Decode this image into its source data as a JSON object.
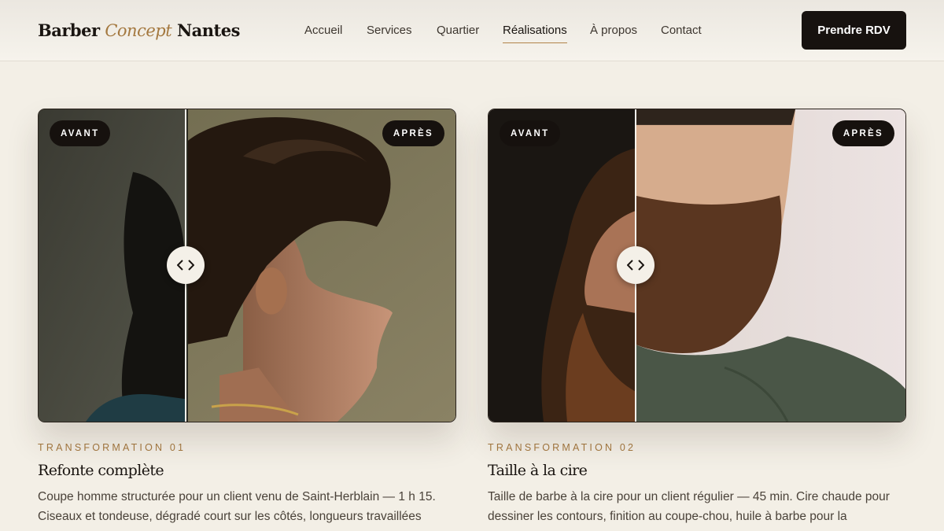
{
  "header": {
    "logo": {
      "part1": "Barber ",
      "part2": "Concept",
      "part3": " Nantes"
    },
    "nav": [
      {
        "label": "Accueil",
        "active": false
      },
      {
        "label": "Services",
        "active": false
      },
      {
        "label": "Quartier",
        "active": false
      },
      {
        "label": "Réalisations",
        "active": true
      },
      {
        "label": "À propos",
        "active": false
      },
      {
        "label": "Contact",
        "active": false
      }
    ],
    "cta_label": "Prendre RDV"
  },
  "cards": [
    {
      "before_label": "AVANT",
      "after_label": "APRÈS",
      "eyebrow": "TRANSFORMATION 01",
      "title": "Refonte complète",
      "description": "Coupe homme structurée pour un client venu de Saint-Herblain — 1 h 15. Ciseaux et tondeuse, dégradé court sur les côtés, longueurs travaillées"
    },
    {
      "before_label": "AVANT",
      "after_label": "APRÈS",
      "eyebrow": "TRANSFORMATION 02",
      "title": "Taille à la cire",
      "description": "Taille de barbe à la cire pour un client régulier — 45 min. Cire chaude pour dessiner les contours, finition au coupe-chou, huile à barbe pour la"
    }
  ],
  "colors": {
    "background": "#f3efe6",
    "accent": "#a4783f",
    "dark": "#17120f"
  }
}
